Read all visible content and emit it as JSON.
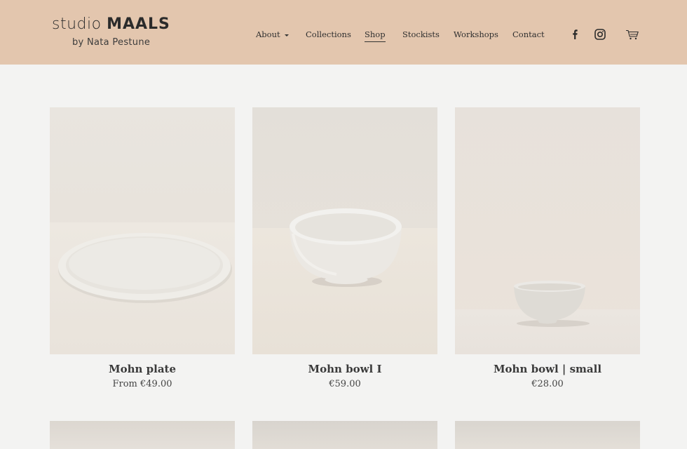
{
  "brand": {
    "name_light": "studio",
    "name_bold": "MAALS",
    "tagline": "by Nata Pestune"
  },
  "nav": {
    "items": [
      {
        "label": "About",
        "has_dropdown": true,
        "active": false
      },
      {
        "label": "Collections",
        "active": false
      },
      {
        "label": "Shop",
        "active": true
      },
      {
        "label": "Stockists",
        "active": false
      },
      {
        "label": "Workshops",
        "active": false
      },
      {
        "label": "Contact",
        "active": false
      }
    ]
  },
  "header_icons": [
    "facebook-icon",
    "instagram-icon",
    "cart-icon"
  ],
  "products": [
    {
      "title": "Mohn plate",
      "price": "From €49.00"
    },
    {
      "title": "Mohn bowl I",
      "price": "€59.00"
    },
    {
      "title": "Mohn bowl | small",
      "price": "€28.00"
    }
  ],
  "colors": {
    "header_bg": "#e3c6ae",
    "page_bg": "#f3f3f2",
    "text": "#333333"
  }
}
